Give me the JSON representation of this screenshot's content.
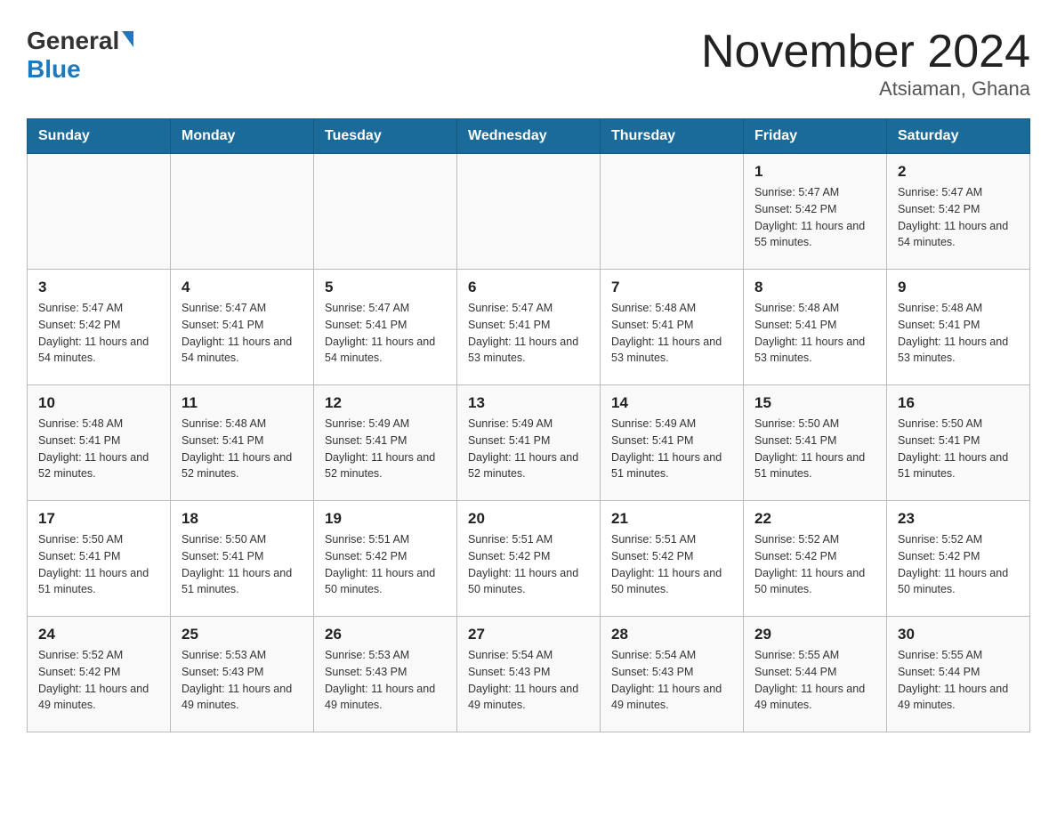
{
  "header": {
    "logo_general": "General",
    "logo_blue": "Blue",
    "title": "November 2024",
    "subtitle": "Atsiaman, Ghana"
  },
  "days_of_week": [
    "Sunday",
    "Monday",
    "Tuesday",
    "Wednesday",
    "Thursday",
    "Friday",
    "Saturday"
  ],
  "weeks": [
    [
      {
        "day": "",
        "info": ""
      },
      {
        "day": "",
        "info": ""
      },
      {
        "day": "",
        "info": ""
      },
      {
        "day": "",
        "info": ""
      },
      {
        "day": "",
        "info": ""
      },
      {
        "day": "1",
        "info": "Sunrise: 5:47 AM\nSunset: 5:42 PM\nDaylight: 11 hours and 55 minutes."
      },
      {
        "day": "2",
        "info": "Sunrise: 5:47 AM\nSunset: 5:42 PM\nDaylight: 11 hours and 54 minutes."
      }
    ],
    [
      {
        "day": "3",
        "info": "Sunrise: 5:47 AM\nSunset: 5:42 PM\nDaylight: 11 hours and 54 minutes."
      },
      {
        "day": "4",
        "info": "Sunrise: 5:47 AM\nSunset: 5:41 PM\nDaylight: 11 hours and 54 minutes."
      },
      {
        "day": "5",
        "info": "Sunrise: 5:47 AM\nSunset: 5:41 PM\nDaylight: 11 hours and 54 minutes."
      },
      {
        "day": "6",
        "info": "Sunrise: 5:47 AM\nSunset: 5:41 PM\nDaylight: 11 hours and 53 minutes."
      },
      {
        "day": "7",
        "info": "Sunrise: 5:48 AM\nSunset: 5:41 PM\nDaylight: 11 hours and 53 minutes."
      },
      {
        "day": "8",
        "info": "Sunrise: 5:48 AM\nSunset: 5:41 PM\nDaylight: 11 hours and 53 minutes."
      },
      {
        "day": "9",
        "info": "Sunrise: 5:48 AM\nSunset: 5:41 PM\nDaylight: 11 hours and 53 minutes."
      }
    ],
    [
      {
        "day": "10",
        "info": "Sunrise: 5:48 AM\nSunset: 5:41 PM\nDaylight: 11 hours and 52 minutes."
      },
      {
        "day": "11",
        "info": "Sunrise: 5:48 AM\nSunset: 5:41 PM\nDaylight: 11 hours and 52 minutes."
      },
      {
        "day": "12",
        "info": "Sunrise: 5:49 AM\nSunset: 5:41 PM\nDaylight: 11 hours and 52 minutes."
      },
      {
        "day": "13",
        "info": "Sunrise: 5:49 AM\nSunset: 5:41 PM\nDaylight: 11 hours and 52 minutes."
      },
      {
        "day": "14",
        "info": "Sunrise: 5:49 AM\nSunset: 5:41 PM\nDaylight: 11 hours and 51 minutes."
      },
      {
        "day": "15",
        "info": "Sunrise: 5:50 AM\nSunset: 5:41 PM\nDaylight: 11 hours and 51 minutes."
      },
      {
        "day": "16",
        "info": "Sunrise: 5:50 AM\nSunset: 5:41 PM\nDaylight: 11 hours and 51 minutes."
      }
    ],
    [
      {
        "day": "17",
        "info": "Sunrise: 5:50 AM\nSunset: 5:41 PM\nDaylight: 11 hours and 51 minutes."
      },
      {
        "day": "18",
        "info": "Sunrise: 5:50 AM\nSunset: 5:41 PM\nDaylight: 11 hours and 51 minutes."
      },
      {
        "day": "19",
        "info": "Sunrise: 5:51 AM\nSunset: 5:42 PM\nDaylight: 11 hours and 50 minutes."
      },
      {
        "day": "20",
        "info": "Sunrise: 5:51 AM\nSunset: 5:42 PM\nDaylight: 11 hours and 50 minutes."
      },
      {
        "day": "21",
        "info": "Sunrise: 5:51 AM\nSunset: 5:42 PM\nDaylight: 11 hours and 50 minutes."
      },
      {
        "day": "22",
        "info": "Sunrise: 5:52 AM\nSunset: 5:42 PM\nDaylight: 11 hours and 50 minutes."
      },
      {
        "day": "23",
        "info": "Sunrise: 5:52 AM\nSunset: 5:42 PM\nDaylight: 11 hours and 50 minutes."
      }
    ],
    [
      {
        "day": "24",
        "info": "Sunrise: 5:52 AM\nSunset: 5:42 PM\nDaylight: 11 hours and 49 minutes."
      },
      {
        "day": "25",
        "info": "Sunrise: 5:53 AM\nSunset: 5:43 PM\nDaylight: 11 hours and 49 minutes."
      },
      {
        "day": "26",
        "info": "Sunrise: 5:53 AM\nSunset: 5:43 PM\nDaylight: 11 hours and 49 minutes."
      },
      {
        "day": "27",
        "info": "Sunrise: 5:54 AM\nSunset: 5:43 PM\nDaylight: 11 hours and 49 minutes."
      },
      {
        "day": "28",
        "info": "Sunrise: 5:54 AM\nSunset: 5:43 PM\nDaylight: 11 hours and 49 minutes."
      },
      {
        "day": "29",
        "info": "Sunrise: 5:55 AM\nSunset: 5:44 PM\nDaylight: 11 hours and 49 minutes."
      },
      {
        "day": "30",
        "info": "Sunrise: 5:55 AM\nSunset: 5:44 PM\nDaylight: 11 hours and 49 minutes."
      }
    ]
  ]
}
